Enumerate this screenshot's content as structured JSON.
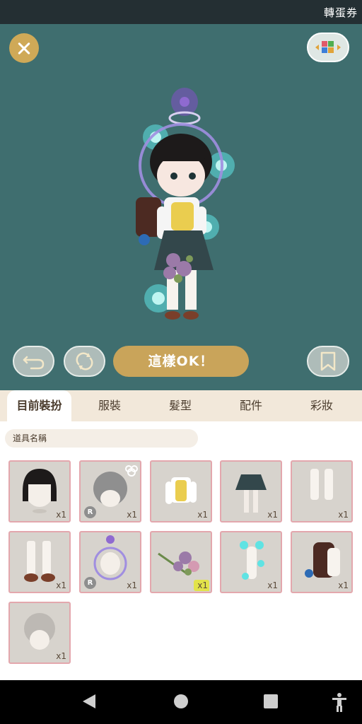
{
  "status_bar": {
    "ticket_label": "轉蛋券"
  },
  "controls": {
    "close_icon": "close-icon",
    "view_toggle_icon": "palette-icon",
    "undo_icon": "undo-icon",
    "refresh_icon": "refresh-icon",
    "ok_label": "這樣OK！",
    "bookmark_icon": "bookmark-icon"
  },
  "tabs": [
    {
      "label": "目前裝扮",
      "active": true
    },
    {
      "label": "服裝",
      "active": false
    },
    {
      "label": "髮型",
      "active": false
    },
    {
      "label": "配件",
      "active": false
    },
    {
      "label": "彩妝",
      "active": false
    }
  ],
  "search": {
    "label": "道具名稱"
  },
  "items": [
    {
      "name": "black-bob-hair",
      "qty": "x1",
      "rare": false,
      "new": false
    },
    {
      "name": "gray-hair-with-bear-ears",
      "qty": "x1",
      "rare": true,
      "new": false
    },
    {
      "name": "school-uniform-top",
      "qty": "x1",
      "rare": false,
      "new": false
    },
    {
      "name": "navy-skirt",
      "qty": "x1",
      "rare": false,
      "new": false
    },
    {
      "name": "white-knee-socks",
      "qty": "x1",
      "rare": false,
      "new": false
    },
    {
      "name": "socks-with-brown-shoes",
      "qty": "x1",
      "rare": false,
      "new": false
    },
    {
      "name": "bubble-ring-halo",
      "qty": "x1",
      "rare": true,
      "new": false
    },
    {
      "name": "flower-bouquet",
      "qty": "x1",
      "rare": false,
      "new": true
    },
    {
      "name": "blue-sparkle-effect",
      "qty": "x1",
      "rare": false,
      "new": false
    },
    {
      "name": "school-backpack",
      "qty": "x1",
      "rare": false,
      "new": false
    },
    {
      "name": "gray-bun-hair",
      "qty": "x1",
      "rare": false,
      "new": false
    }
  ],
  "nav": {
    "back_icon": "back-icon",
    "home_icon": "home-icon",
    "recents_icon": "recents-icon",
    "accessibility_icon": "accessibility-icon"
  },
  "colors": {
    "stage": "#3f6e6f",
    "gold": "#c9a45a",
    "tab_bar": "#f2e8da",
    "item_border": "#e3a7ad"
  }
}
